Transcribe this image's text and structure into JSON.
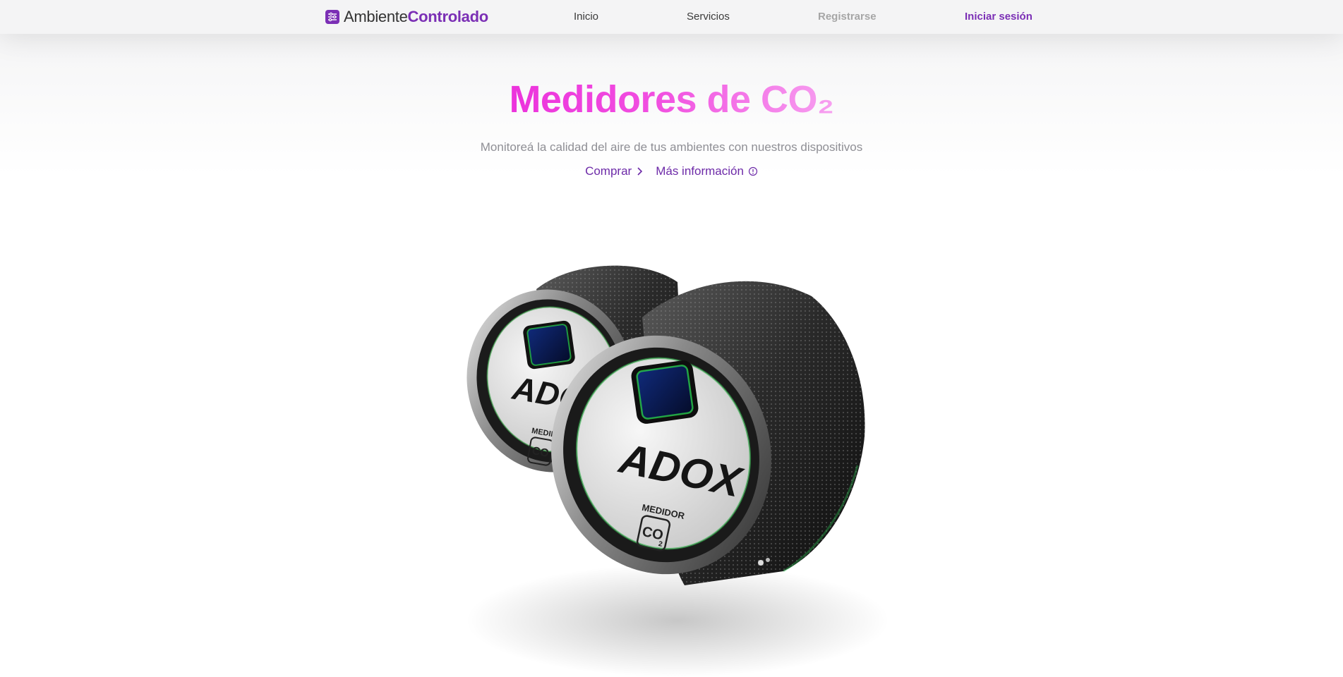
{
  "brand": {
    "name_light": "Ambiente",
    "name_bold": "Controlado",
    "icon": "sliders-icon",
    "accent_color": "#7b2fb5"
  },
  "nav": {
    "items": [
      {
        "label": "Inicio"
      },
      {
        "label": "Servicios"
      },
      {
        "label": "Registrarse"
      },
      {
        "label": "Iniciar sesión"
      }
    ]
  },
  "hero": {
    "title": "Medidores de CO₂",
    "subtitle": "Monitoreá la calidad del aire de tus ambientes con nuestros dispositivos",
    "cta_buy": "Comprar",
    "cta_buy_icon": "chevron-right-icon",
    "cta_info": "Más información",
    "cta_info_icon": "info-circle-icon",
    "title_gradient": [
      "#ec33dc",
      "#f7a0f0"
    ]
  },
  "product": {
    "brand_text": "ADOX",
    "label_top": "MEDIDOR",
    "label_co2": "CO",
    "label_sub": "2"
  }
}
